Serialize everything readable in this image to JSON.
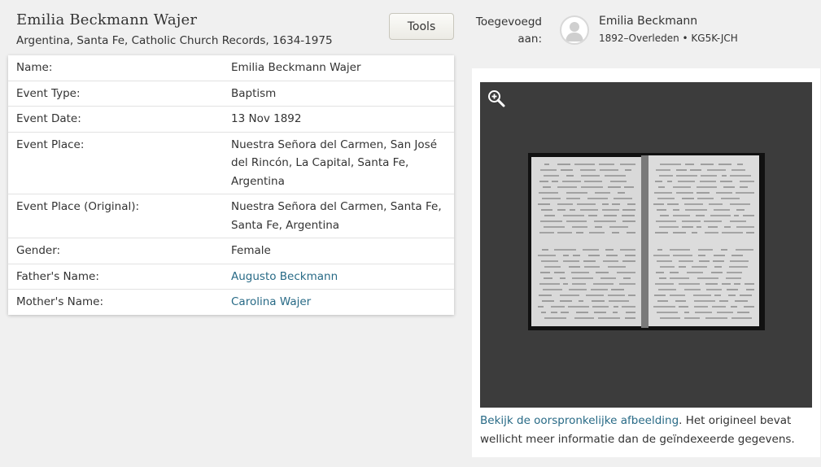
{
  "record": {
    "name": "Emilia Beckmann Wajer",
    "collection": "Argentina, Santa Fe, Catholic Church Records, 1634-1975"
  },
  "toolbar": {
    "tools_label": "Tools"
  },
  "attached": {
    "label_line1": "Toegevoegd",
    "label_line2": "aan:",
    "person_name": "Emilia Beckmann",
    "person_meta": "1892–Overleden • KG5K-JCH",
    "avatar_icon": "person-silhouette-icon"
  },
  "details": [
    {
      "label": "Name:",
      "value": "Emilia Beckmann Wajer",
      "link": false
    },
    {
      "label": "Event Type:",
      "value": "Baptism",
      "link": false
    },
    {
      "label": "Event Date:",
      "value": "13 Nov 1892",
      "link": false
    },
    {
      "label": "Event Place:",
      "value": "Nuestra Señora del Carmen, San José del Rincón, La Capital, Santa Fe, Argentina",
      "link": false
    },
    {
      "label": "Event Place (Original):",
      "value": "Nuestra Señora del Carmen, Santa Fe, Santa Fe, Argentina",
      "link": false
    },
    {
      "label": "Gender:",
      "value": "Female",
      "link": false
    },
    {
      "label": "Father's Name:",
      "value": "Augusto Beckmann",
      "link": true
    },
    {
      "label": "Mother's Name:",
      "value": "Carolina Wajer",
      "link": true
    }
  ],
  "image": {
    "zoom_icon": "zoom-in-icon",
    "view_link": "Bekijk de oorspronkelijke afbeelding",
    "caption_rest": ". Het origineel bevat wellicht meer informatie dan de geïndexeerde gegevens."
  },
  "colors": {
    "link": "#286a86",
    "page_background": "#f0f0f0",
    "viewer_background": "#3c3c3c"
  }
}
